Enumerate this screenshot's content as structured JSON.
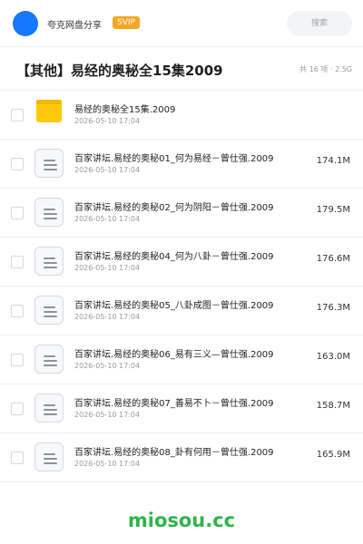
{
  "header": {
    "brand": "夸克网盘分享",
    "badge": "SVIP",
    "search_placeholder": "搜索"
  },
  "share": {
    "title": "【其他】易经的奥秘全15集2009",
    "summary": "共 16 项 · 2.5G"
  },
  "files": [
    {
      "type": "folder",
      "name": "易经的奥秘全15集.2009",
      "date": "2026-05-10 17:04",
      "size": ""
    },
    {
      "type": "file",
      "name": "百家讲坛.易经的奥秘01_何为易经－曾仕强.2009",
      "date": "2026-05-10 17:04",
      "size": "174.1M"
    },
    {
      "type": "file",
      "name": "百家讲坛.易经的奥秘02_何为阴阳－曾仕强.2009",
      "date": "2026-05-10 17:04",
      "size": "179.5M"
    },
    {
      "type": "file",
      "name": "百家讲坛.易经的奥秘04_何为八卦－曾仕强.2009",
      "date": "2026-05-10 17:04",
      "size": "176.6M"
    },
    {
      "type": "file",
      "name": "百家讲坛.易经的奥秘05_八卦成图－曾仕强.2009",
      "date": "2026-05-10 17:04",
      "size": "176.3M"
    },
    {
      "type": "file",
      "name": "百家讲坛.易经的奥秘06_易有三义—曾仕强.2009",
      "date": "2026-05-10 17:04",
      "size": "163.0M"
    },
    {
      "type": "file",
      "name": "百家讲坛.易经的奥秘07_善易不卜－曾仕强.2009",
      "date": "2026-05-10 17:04",
      "size": "158.7M"
    },
    {
      "type": "file",
      "name": "百家讲坛.易经的奥秘08_卦有何用－曾仕强.2009",
      "date": "2026-05-10 17:04",
      "size": "165.9M"
    }
  ],
  "footer": {
    "watermark": "miosou.cc",
    "watermark_color": "#2fb34a"
  },
  "colors": {
    "accent": "#1677ff",
    "badge": "#f5a623",
    "folder": "#ffc90b"
  }
}
